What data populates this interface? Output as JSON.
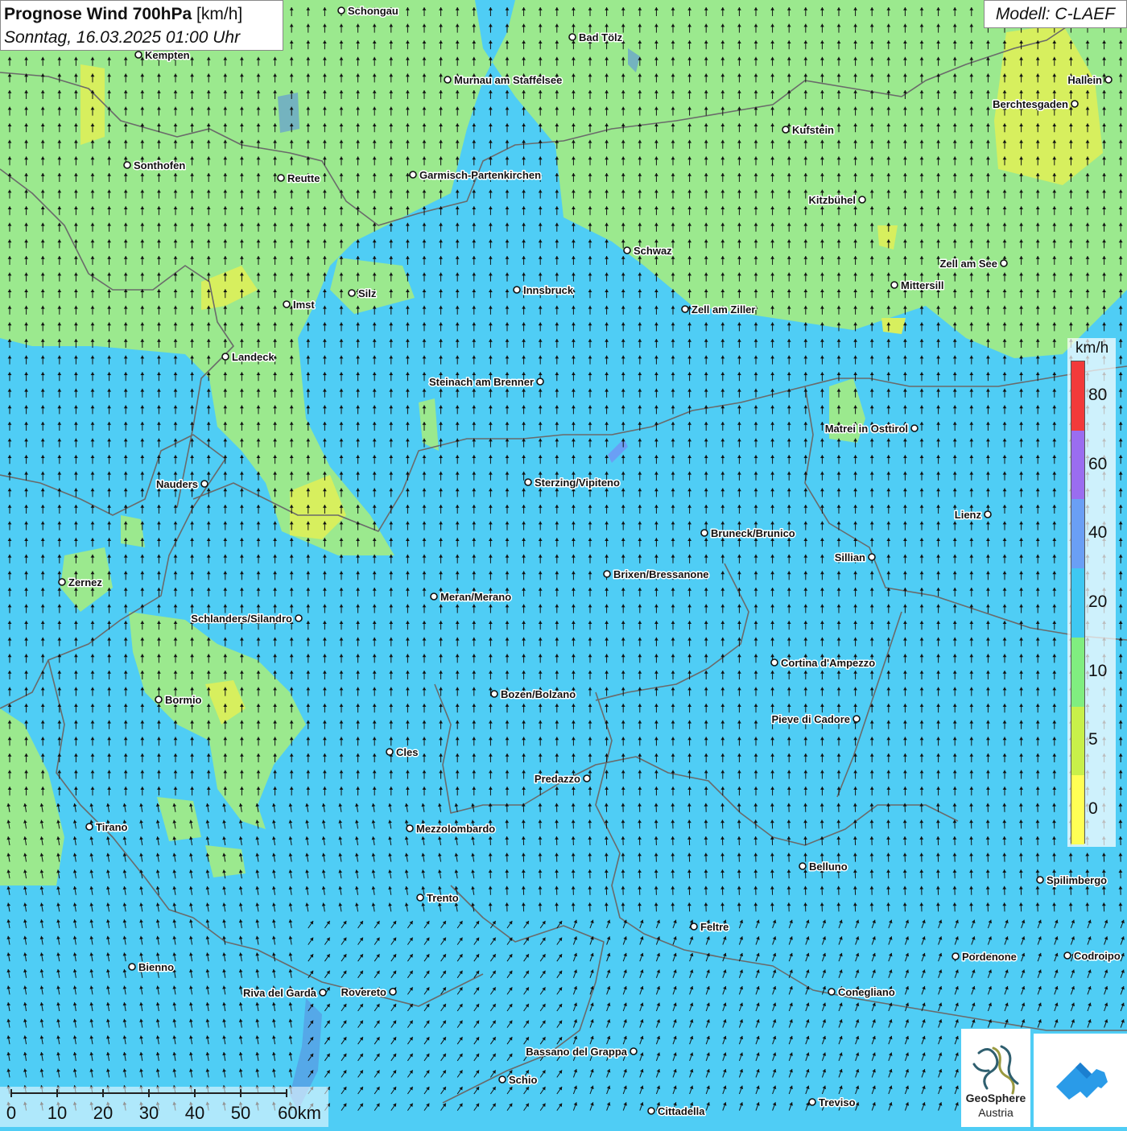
{
  "title": {
    "bold": "Prognose Wind 700hPa",
    "unit": "[km/h]",
    "datetime": "Sonntag, 16.03.2025 01:00 Uhr"
  },
  "model": "Modell: C-LAEF",
  "legend": {
    "unit": "km/h",
    "ticks": [
      "0",
      "5",
      "10",
      "20",
      "40",
      "60",
      "80"
    ],
    "colors": [
      "#ffff55",
      "#c8f04a",
      "#80ee80",
      "#3fc8f2",
      "#6a9ff5",
      "#9a6df0",
      "#f23a3a"
    ]
  },
  "scalebar": {
    "labels": [
      "0",
      "10",
      "20",
      "30",
      "40",
      "50",
      "60km"
    ]
  },
  "logo": {
    "name1": "GeoSphere",
    "name2": "Austria"
  },
  "map_colors": {
    "calm_green": "#9be98e",
    "light_yellow": "#d7ef5e",
    "wind_blue": "#4fcdf5",
    "border": "#6a6a6a"
  },
  "wind_direction": "mostly from south (arrows pointing north / north-west)",
  "cities": [
    {
      "name": "Schongau"
    },
    {
      "name": "Bad Tölz"
    },
    {
      "name": "Kempten"
    },
    {
      "name": "Murnau am Staffelsee"
    },
    {
      "name": "Hallein"
    },
    {
      "name": "Berchtesgaden"
    },
    {
      "name": "Kufstein"
    },
    {
      "name": "Sonthofen"
    },
    {
      "name": "Reutte"
    },
    {
      "name": "Garmisch-Partenkirchen"
    },
    {
      "name": "Kitzbühel"
    },
    {
      "name": "Schwaz"
    },
    {
      "name": "Zell am See"
    },
    {
      "name": "Mittersill"
    },
    {
      "name": "Silz"
    },
    {
      "name": "Innsbruck"
    },
    {
      "name": "Imst"
    },
    {
      "name": "Zell am Ziller"
    },
    {
      "name": "Landeck"
    },
    {
      "name": "Steinach am Brenner"
    },
    {
      "name": "Matrei in Osttirol"
    },
    {
      "name": "Nauders"
    },
    {
      "name": "Sterzing/Vipiteno"
    },
    {
      "name": "Lienz"
    },
    {
      "name": "Bruneck/Brunico"
    },
    {
      "name": "Sillian"
    },
    {
      "name": "Brixen/Bressanone"
    },
    {
      "name": "Zernez"
    },
    {
      "name": "Meran/Merano"
    },
    {
      "name": "Schlanders/Silandro"
    },
    {
      "name": "Cortina d'Ampezzo"
    },
    {
      "name": "Bozen/Bolzano"
    },
    {
      "name": "Bormio"
    },
    {
      "name": "Pieve di Cadore"
    },
    {
      "name": "Cles"
    },
    {
      "name": "Predazzo"
    },
    {
      "name": "Tirano"
    },
    {
      "name": "Mezzolombardo"
    },
    {
      "name": "Belluno"
    },
    {
      "name": "Spilimbergo"
    },
    {
      "name": "Trento"
    },
    {
      "name": "Feltre"
    },
    {
      "name": "Pordenone"
    },
    {
      "name": "Codroipo"
    },
    {
      "name": "Bienno"
    },
    {
      "name": "Riva del Garda"
    },
    {
      "name": "Rovereto"
    },
    {
      "name": "Conegliano"
    },
    {
      "name": "Bassano del Grappa"
    },
    {
      "name": "Schio"
    },
    {
      "name": "Treviso"
    },
    {
      "name": "Cittadella"
    }
  ]
}
